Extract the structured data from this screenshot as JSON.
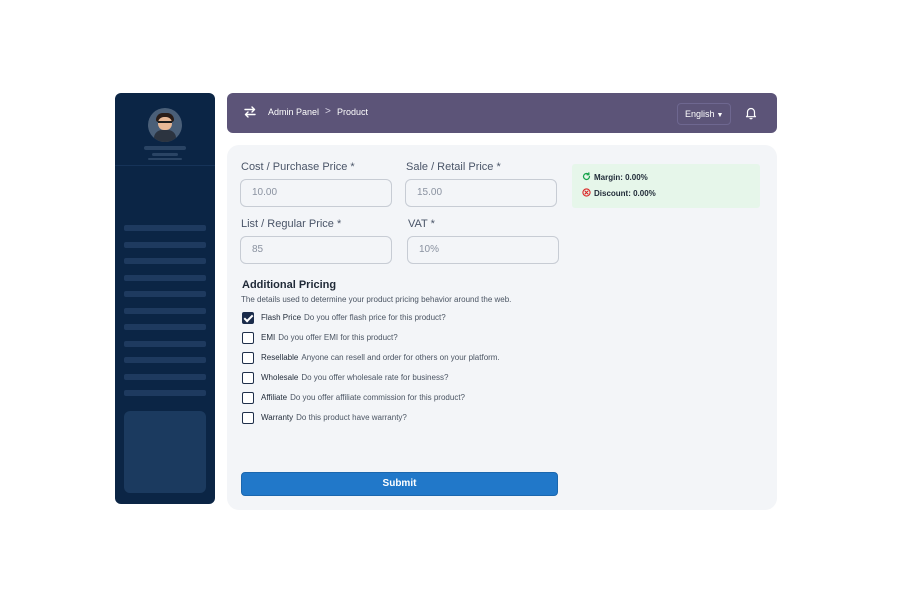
{
  "header": {
    "breadcrumb_home": "Admin Panel",
    "breadcrumb_separator": ">",
    "breadcrumb_current": "Product",
    "language": "English",
    "icons": [
      "swap-icon",
      "bell-icon",
      "caret-down-icon"
    ]
  },
  "form": {
    "cost_label": "Cost / Purchase Price *",
    "cost_value": "10.00",
    "sale_label": "Sale / Retail Price *",
    "sale_value": "15.00",
    "list_label": "List / Regular Price *",
    "list_value": "85",
    "vat_label": "VAT *",
    "vat_value": "10%"
  },
  "additional": {
    "title": "Additional Pricing",
    "description": "The details used to determine your product pricing behavior around the web.",
    "options": [
      {
        "name": "Flash Price",
        "desc": "Do you offer flash price for this product?",
        "checked": true
      },
      {
        "name": "EMI",
        "desc": "Do you offer EMI for this product?",
        "checked": false
      },
      {
        "name": "Resellable",
        "desc": "Anyone can resell and order for others on your platform.",
        "checked": false
      },
      {
        "name": "Wholesale",
        "desc": "Do you offer wholesale rate for business?",
        "checked": false
      },
      {
        "name": "Affiliate",
        "desc": "Do you offer affiliate commission for this product?",
        "checked": false
      },
      {
        "name": "Warranty",
        "desc": "Do this product have warranty?",
        "checked": false
      }
    ]
  },
  "submit_label": "Submit",
  "summary": {
    "margin": "Margin: 0.00%",
    "discount": "Discount: 0.00%"
  },
  "colors": {
    "sidebar": "#0b2545",
    "topbar": "#5c5478",
    "submit": "#2178c9",
    "summary_bg": "#e6f6ea",
    "margin_icon": "#16a34a",
    "discount_icon": "#dc2626"
  }
}
